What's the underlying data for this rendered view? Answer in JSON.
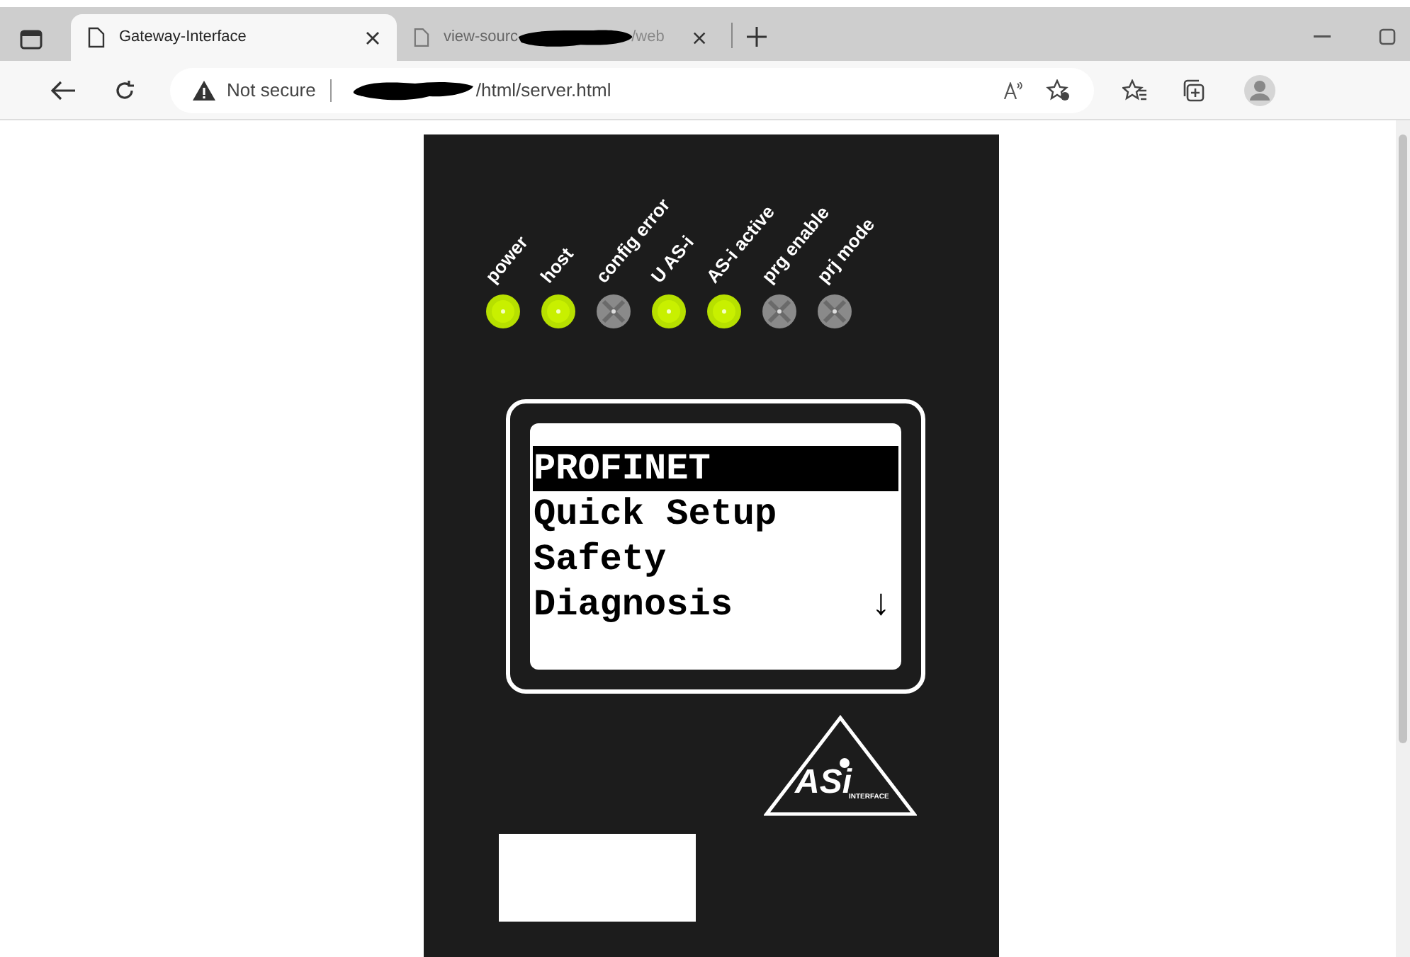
{
  "browser": {
    "tabs": [
      {
        "title": "Gateway-Interface",
        "selected": true
      },
      {
        "title": "view-sourc",
        "title_end": "/web",
        "selected": false
      }
    ],
    "address": {
      "security": "Not secure",
      "url": "/html/server.html"
    }
  },
  "device": {
    "leds": [
      {
        "label": "power",
        "on": true
      },
      {
        "label": "host",
        "on": true
      },
      {
        "label": "config error",
        "on": false
      },
      {
        "label": "U AS-i",
        "on": true
      },
      {
        "label": "AS-i active",
        "on": true
      },
      {
        "label": "prg enable",
        "on": false
      },
      {
        "label": "prj mode",
        "on": false
      }
    ],
    "menu": {
      "items": [
        {
          "label": "PROFINET",
          "selected": true
        },
        {
          "label": "Quick Setup",
          "selected": false
        },
        {
          "label": "Safety",
          "selected": false
        },
        {
          "label": "Diagnosis",
          "selected": false
        }
      ],
      "scroll_hint": "↓"
    },
    "logo": {
      "main": "ASi",
      "sub": "INTERFACE"
    }
  }
}
